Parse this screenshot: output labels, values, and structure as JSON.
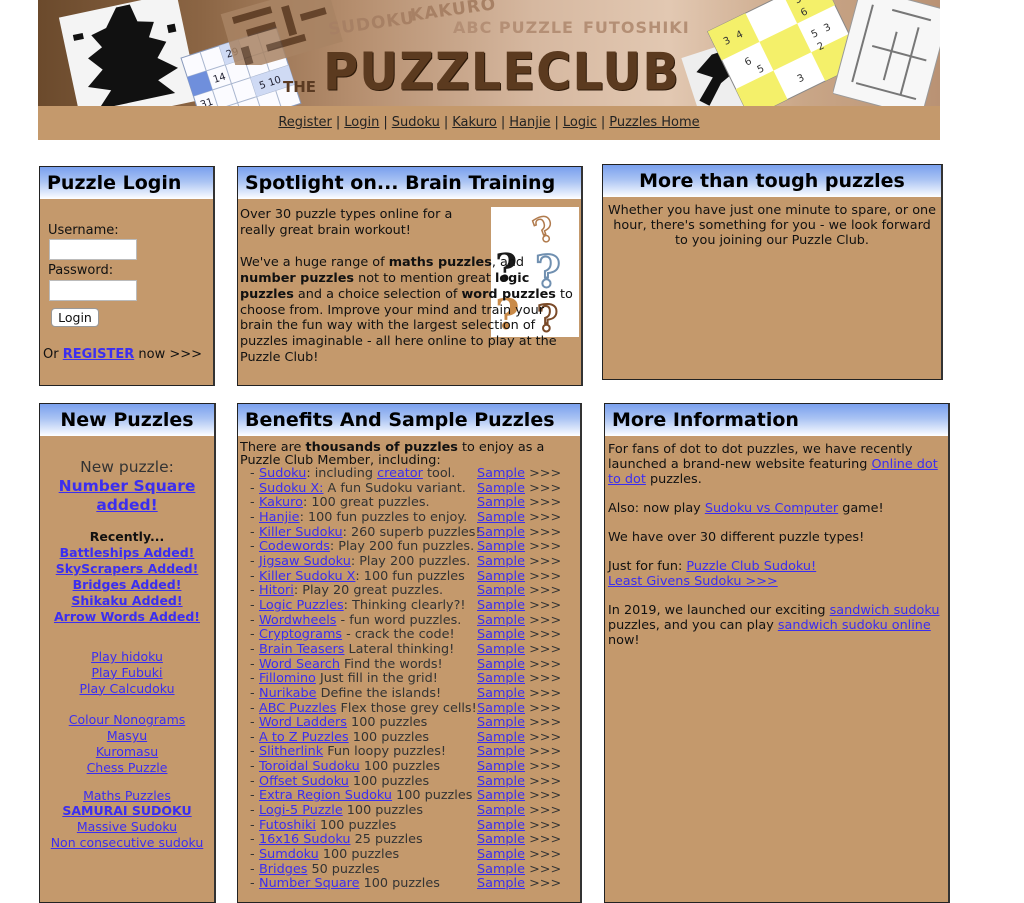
{
  "banner": {
    "logo_prefix": "THE",
    "logo_text": "PUZZLECLUB",
    "tagline_words": [
      "SUDOKU",
      "KAKURO",
      "ABC PUZZLE",
      "FUTOSHIKI"
    ]
  },
  "nav": {
    "items": [
      "Register",
      "Login",
      "Sudoku",
      "Kakuro",
      "Hanjie",
      "Logic",
      "Puzzles Home"
    ],
    "separator": "|"
  },
  "login": {
    "title": "Puzzle Login",
    "username_label": "Username:",
    "username_value": "",
    "password_label": "Password:",
    "password_value": "",
    "button": "Login",
    "register_prefix": "Or ",
    "register_link": "REGISTER",
    "register_suffix": " now >>>"
  },
  "spotlight": {
    "title": "Spotlight on... Brain Training",
    "para1": "Over 30 puzzle types online for a really great brain workout!",
    "para2_parts": [
      "We've a huge range of ",
      "maths puzzles",
      ", and ",
      "number puzzles",
      " not to mention great ",
      "logic puzzles",
      " and a choice selection of ",
      "word puzzles",
      " to choose from. Improve your mind and train your brain the fun way with the largest selection of puzzles imaginable - all here online to play at the Puzzle Club!"
    ],
    "image_alt": "question marks"
  },
  "tough": {
    "title": "More than tough puzzles",
    "text": "Whether you have just one minute to spare, or one hour, there's something for you - we look forward to you joining our Puzzle Club."
  },
  "new_puzzles": {
    "title": "New Puzzles",
    "new_label": "New puzzle:",
    "feature_link": "Number Square added!",
    "recently_label": "Recently...",
    "recent": [
      "Battleships Added!",
      "SkyScrapers Added!",
      "Bridges Added!",
      "Shikaku Added!",
      "Arrow Words Added!"
    ],
    "group1": [
      "Play hidoku",
      "Play Fubuki",
      "Play Calcudoku"
    ],
    "group2": [
      "Colour Nonograms",
      "Masyu",
      "Kuromasu",
      "Chess Puzzle"
    ],
    "group3": [
      "Maths Puzzles",
      "SAMURAI SUDOKU",
      "Massive Sudoku",
      "Non consecutive sudoku"
    ]
  },
  "benefits": {
    "title": "Benefits And Sample Puzzles",
    "intro_pre": "There are ",
    "intro_bold": "thousands of puzzles",
    "intro_post": " to enjoy as a Puzzle Club Member, including:",
    "sample_label": "Sample",
    "sample_arrow": ">>>",
    "items": [
      {
        "link": "Sudoku",
        "text": ": including ",
        "link2": "creator",
        "text2": " tool."
      },
      {
        "link": "Sudoku X:",
        "text": " A fun Sudoku variant."
      },
      {
        "link": "Kakuro",
        "text": ": 100 great puzzles."
      },
      {
        "link": "Hanjie",
        "text": ": 100 fun puzzles to enjoy."
      },
      {
        "link": "Killer Sudoku",
        "text": ": 260 superb puzzles!"
      },
      {
        "link": "Codewords",
        "text": ": Play 200 fun puzzles."
      },
      {
        "link": "Jigsaw Sudoku",
        "text": ": Play 200 puzzles."
      },
      {
        "link": "Killer Sudoku X",
        "text": ": 100 fun puzzles"
      },
      {
        "link": "Hitori",
        "text": ": Play 20 great puzzles."
      },
      {
        "link": "Logic Puzzles",
        "text": ": Thinking clearly?!"
      },
      {
        "link": "Wordwheels",
        "text": " - fun word puzzles."
      },
      {
        "link": "Cryptograms",
        "text": " - crack the code!"
      },
      {
        "link": "Brain Teasers",
        "text": " Lateral thinking!"
      },
      {
        "link": "Word Search",
        "text": " Find the words!"
      },
      {
        "link": "Fillomino",
        "text": " Just fill in the grid!"
      },
      {
        "link": "Nurikabe",
        "text": " Define the islands!"
      },
      {
        "link": "ABC Puzzles",
        "text": " Flex those grey cells!"
      },
      {
        "link": "Word Ladders",
        "text": " 100 puzzles"
      },
      {
        "link": "A to Z Puzzles",
        "text": " 100 puzzles"
      },
      {
        "link": "Slitherlink",
        "text": " Fun loopy puzzles!"
      },
      {
        "link": "Toroidal Sudoku",
        "text": " 100 puzzles"
      },
      {
        "link": "Offset Sudoku",
        "text": " 100 puzzles"
      },
      {
        "link": "Extra Region Sudoku",
        "text": " 100 puzzles"
      },
      {
        "link": "Logi-5 Puzzle",
        "text": " 100 puzzles"
      },
      {
        "link": "Futoshiki",
        "text": " 100 puzzles"
      },
      {
        "link": "16x16 Sudoku",
        "text": " 25 puzzles"
      },
      {
        "link": "Sumdoku",
        "text": " 100 puzzles"
      },
      {
        "link": "Bridges",
        "text": " 50 puzzles"
      },
      {
        "link": "Number Square",
        "text": " 100 puzzles"
      }
    ]
  },
  "more_info": {
    "title": "More Information",
    "p1_pre": "For fans of dot to dot puzzles, we have recently launched a brand-new website featuring ",
    "p1_link": "Online dot to dot",
    "p1_post": " puzzles.",
    "p2_pre": "Also: now play ",
    "p2_link": "Sudoku vs Computer",
    "p2_post": " game!",
    "p3": "We have over 30 different puzzle types!",
    "p4_pre": "Just for fun: ",
    "p4_link": "Puzzle Club Sudoku!",
    "p4_link2": "Least Givens Sudoku >>>",
    "p5_pre": "In 2019, we launched our exciting ",
    "p5_link": "sandwich sudoku",
    "p5_mid": " puzzles, and you can play ",
    "p5_link2": "sandwich sudoku online",
    "p5_post": " now!"
  },
  "colors": {
    "panel_bg": "#c4996c",
    "header_gradient_top": "#7aa0ee",
    "link": "#3b2ef0"
  }
}
